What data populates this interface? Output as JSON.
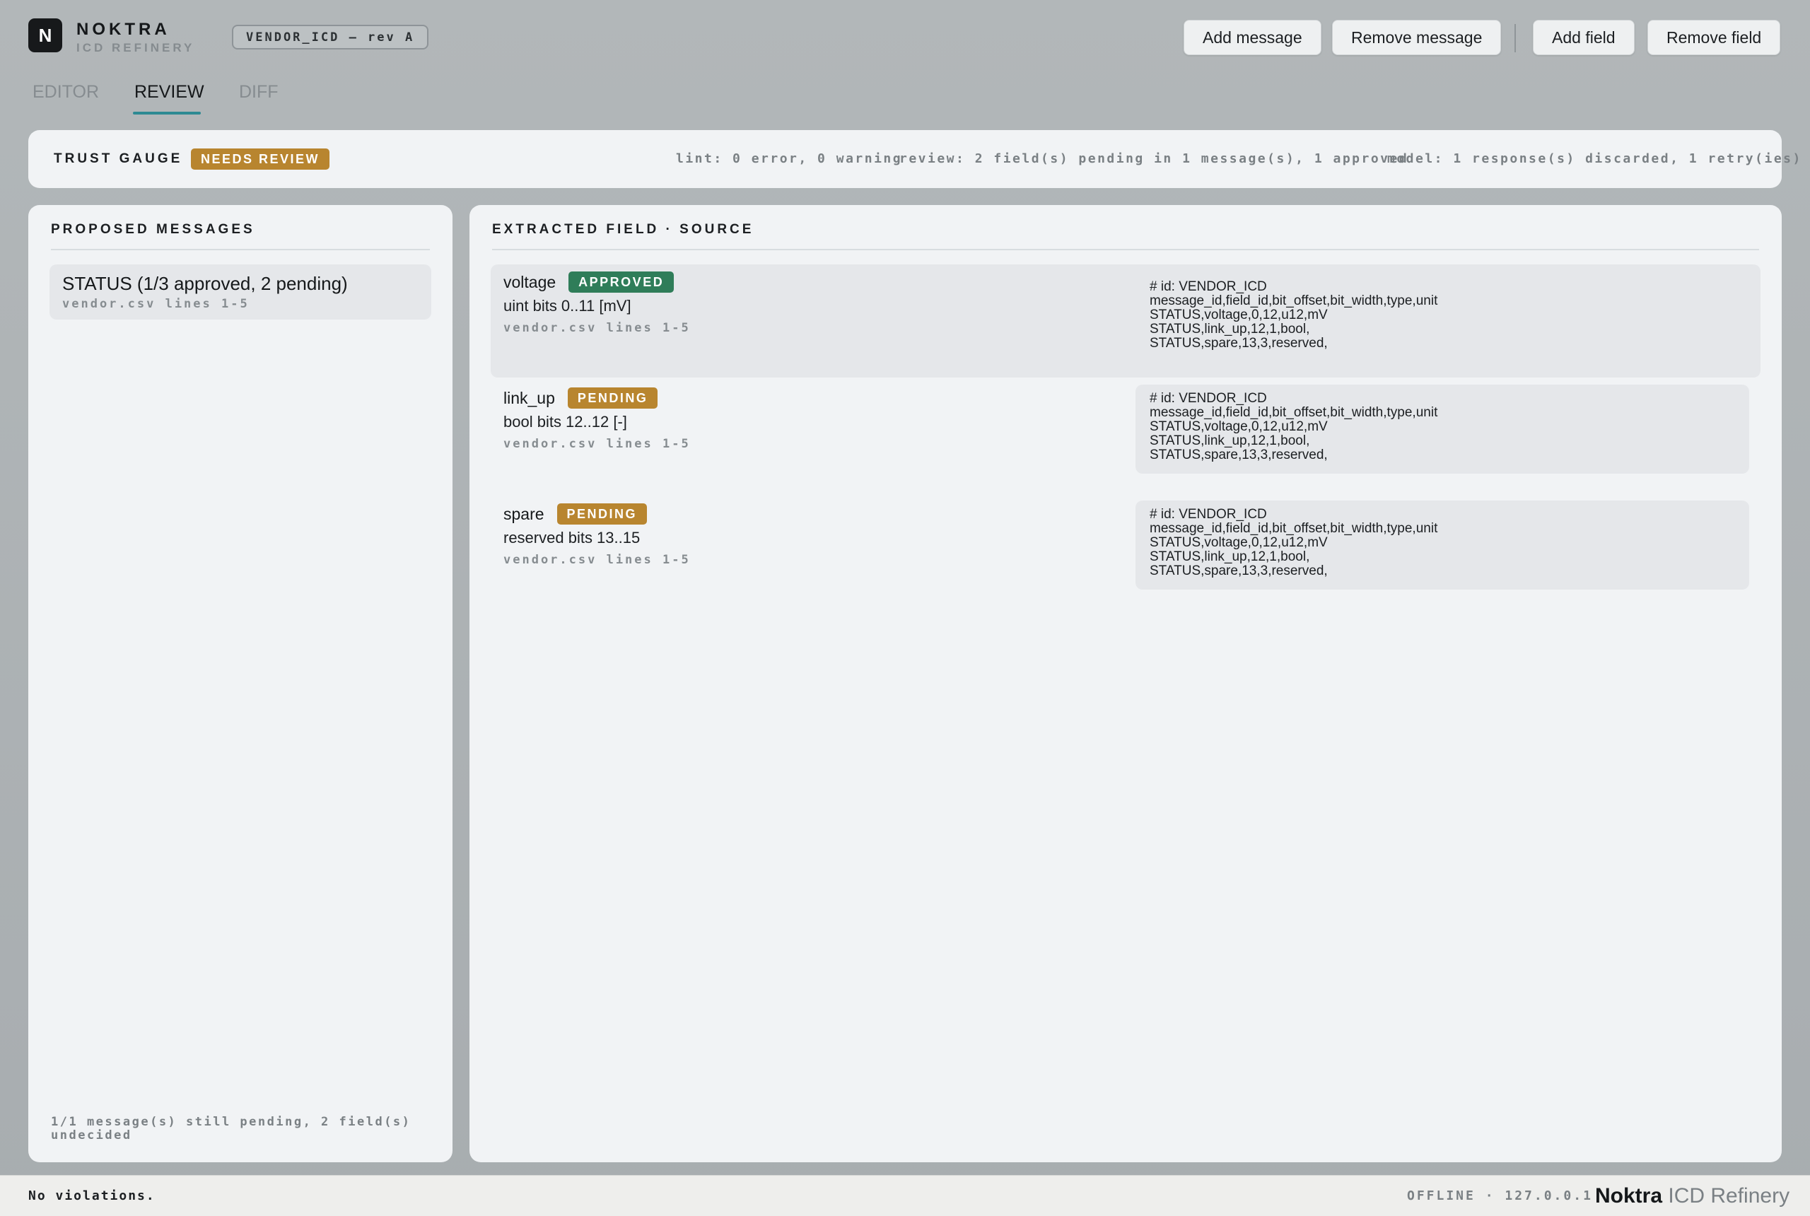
{
  "app": {
    "logo_letter": "N",
    "name": "NOKTRA",
    "subtitle": "ICD REFINERY",
    "document_chip": "VENDOR_ICD — rev A"
  },
  "toolbar": {
    "add_message": "Add message",
    "remove_message": "Remove message",
    "add_field": "Add field",
    "remove_field": "Remove field"
  },
  "tabs": [
    {
      "label": "EDITOR",
      "active": false
    },
    {
      "label": "REVIEW",
      "active": true
    },
    {
      "label": "DIFF",
      "active": false
    }
  ],
  "trust": {
    "label": "TRUST GAUGE",
    "badge": "NEEDS REVIEW",
    "lint": "lint: 0 error, 0 warning",
    "review": "review: 2 field(s) pending in 1 message(s), 1 approved",
    "model": "model: 1 response(s) discarded, 1 retry(ies)"
  },
  "messages_panel": {
    "title": "PROPOSED MESSAGES",
    "items": [
      {
        "title": "STATUS  (1/3 approved, 2 pending)",
        "source": "vendor.csv lines 1-5"
      }
    ],
    "footer": "1/1 message(s) still pending, 2 field(s) undecided"
  },
  "fields_panel": {
    "title": "EXTRACTED FIELD  ·  SOURCE",
    "fields": [
      {
        "name": "voltage",
        "status": "APPROVED",
        "detail": "uint  bits 0..11  [mV]",
        "source": "vendor.csv lines 1-5",
        "snippet": "# id: VENDOR_ICD\nmessage_id,field_id,bit_offset,bit_width,type,unit\nSTATUS,voltage,0,12,u12,mV\nSTATUS,link_up,12,1,bool,\nSTATUS,spare,13,3,reserved,"
      },
      {
        "name": "link_up",
        "status": "PENDING",
        "detail": "bool  bits 12..12  [-]",
        "source": "vendor.csv lines 1-5",
        "snippet": "# id: VENDOR_ICD\nmessage_id,field_id,bit_offset,bit_width,type,unit\nSTATUS,voltage,0,12,u12,mV\nSTATUS,link_up,12,1,bool,\nSTATUS,spare,13,3,reserved,"
      },
      {
        "name": "spare",
        "status": "PENDING",
        "detail": "reserved  bits 13..15",
        "source": "vendor.csv lines 1-5",
        "snippet": "# id: VENDOR_ICD\nmessage_id,field_id,bit_offset,bit_width,type,unit\nSTATUS,voltage,0,12,u12,mV\nSTATUS,link_up,12,1,bool,\nSTATUS,spare,13,3,reserved,"
      }
    ]
  },
  "statusbar": {
    "message": "No violations.",
    "connection": "OFFLINE · 127.0.0.1",
    "brand_bold": "Noktra",
    "brand_light": "ICD Refinery"
  },
  "colors": {
    "accent_tab": "#2e8a93",
    "approved": "#2f7d59",
    "pending": "#b8852f"
  }
}
